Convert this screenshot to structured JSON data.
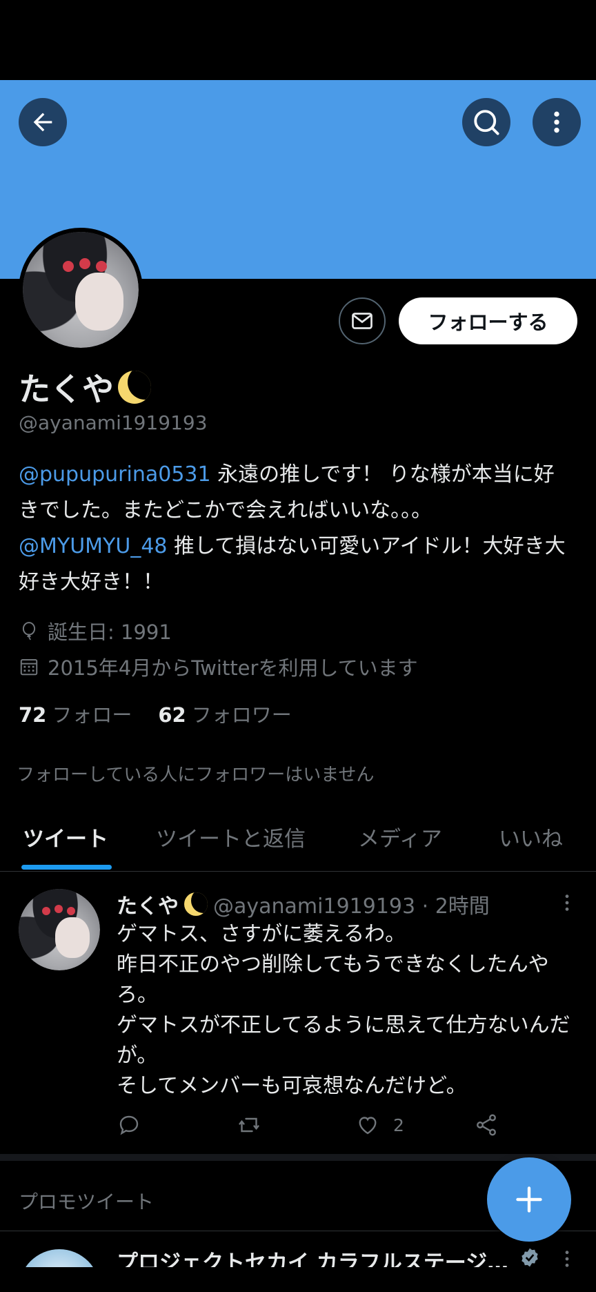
{
  "header": {
    "back_icon": "arrow-left-icon",
    "search_icon": "search-icon",
    "more_icon": "more-vertical-icon",
    "banner_color": "#4b9be8"
  },
  "profile": {
    "display_name": "たくや",
    "handle": "@ayanami1919193",
    "follow_label": "フォローする",
    "dm_icon": "envelope-icon",
    "bio": {
      "mention_1": "@pupupurina0531",
      "text_1": " 永遠の推しです！ りな様が本当に好きでした。またどこかで会えればいいな。。。",
      "mention_2": "@MYUMYU_48",
      "text_2": " 推して損はない可愛いアイドル！大好き大好き大好き！！"
    },
    "birthday": "誕生日: 1991",
    "joined": "2015年4月からTwitterを利用しています",
    "following_count": "72",
    "following_label": "フォロー",
    "followers_count": "62",
    "followers_label": "フォロワー",
    "no_mutuals": "フォローしている人にフォロワーはいません"
  },
  "tabs": [
    {
      "label": "ツイート",
      "active": true
    },
    {
      "label": "ツイートと返信",
      "active": false
    },
    {
      "label": "メディア",
      "active": false
    },
    {
      "label": "いいね",
      "active": false
    }
  ],
  "tweet": {
    "name": "たくや",
    "meta": "@ayanami1919193 · 2時間",
    "text": "ゲマトス、さすがに萎えるわ。\n昨日不正のやつ削除してもうできなくしたんやろ。\nゲマトスが不正してるように思えて仕方ないんだが。\nそしてメンバーも可哀想なんだけど。",
    "like_count": "2"
  },
  "promo": {
    "label": "プロモツイート",
    "title": "プロジェクトセカイ カラフルステージ！ feat. 初音ミク"
  },
  "fab": {
    "icon": "plus-icon"
  },
  "colors": {
    "accent": "#1d9bf0",
    "mention": "#4c9be8",
    "muted": "#71767b"
  }
}
